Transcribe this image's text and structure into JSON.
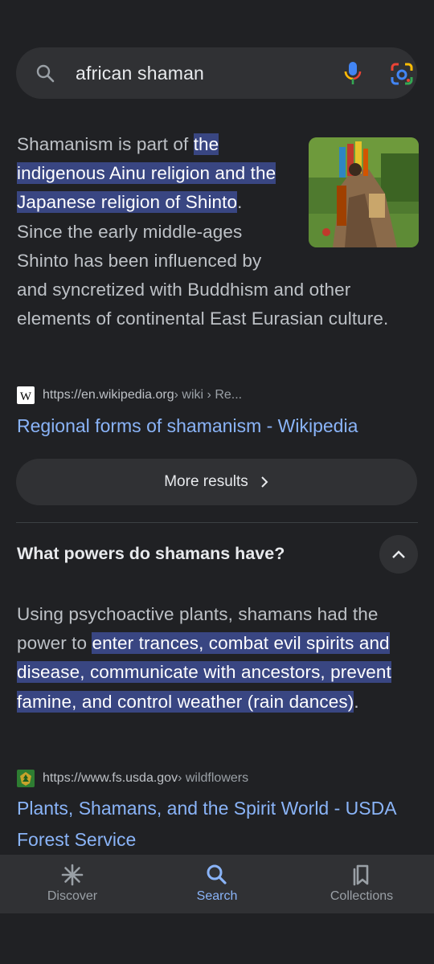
{
  "search": {
    "query": "african shaman"
  },
  "result1": {
    "text_before": "Shamanism is part of ",
    "text_highlight": "the indigenous Ainu religion and the Japanese religion of Shinto",
    "text_after": ". Since the early middle-ages Shinto has been influenced by and syncretized with Buddhism and other elements of continental East Eurasian culture.",
    "source_url": "https://en.wikipedia.org",
    "source_crumb": " › wiki › Re...",
    "title": "Regional forms of shamanism - Wikipedia",
    "favicon": "wikipedia-icon"
  },
  "more_results": {
    "label": "More results"
  },
  "question": {
    "label": "What powers do shamans have?"
  },
  "result2": {
    "text_before": "Using psychoactive plants, shamans had the power to ",
    "text_highlight": "enter trances, combat evil spirits and disease, communicate with ancestors, prevent famine, and control weather (rain dances)",
    "text_after": ".",
    "source_url": "https://www.fs.usda.gov",
    "source_crumb": " › wildflowers",
    "title": "Plants, Shamans, and the Spirit World - USDA Forest Service",
    "favicon": "usda-forest-service-icon"
  },
  "nav": {
    "items": [
      {
        "label": "Discover",
        "icon": "asterisk-icon",
        "active": false
      },
      {
        "label": "Search",
        "icon": "search-icon",
        "active": true
      },
      {
        "label": "Collections",
        "icon": "collections-icon",
        "active": false
      }
    ]
  },
  "colors": {
    "background": "#202124",
    "highlight": "#394682",
    "link": "#8ab4f8",
    "active_nav": "#8ab4f8"
  }
}
